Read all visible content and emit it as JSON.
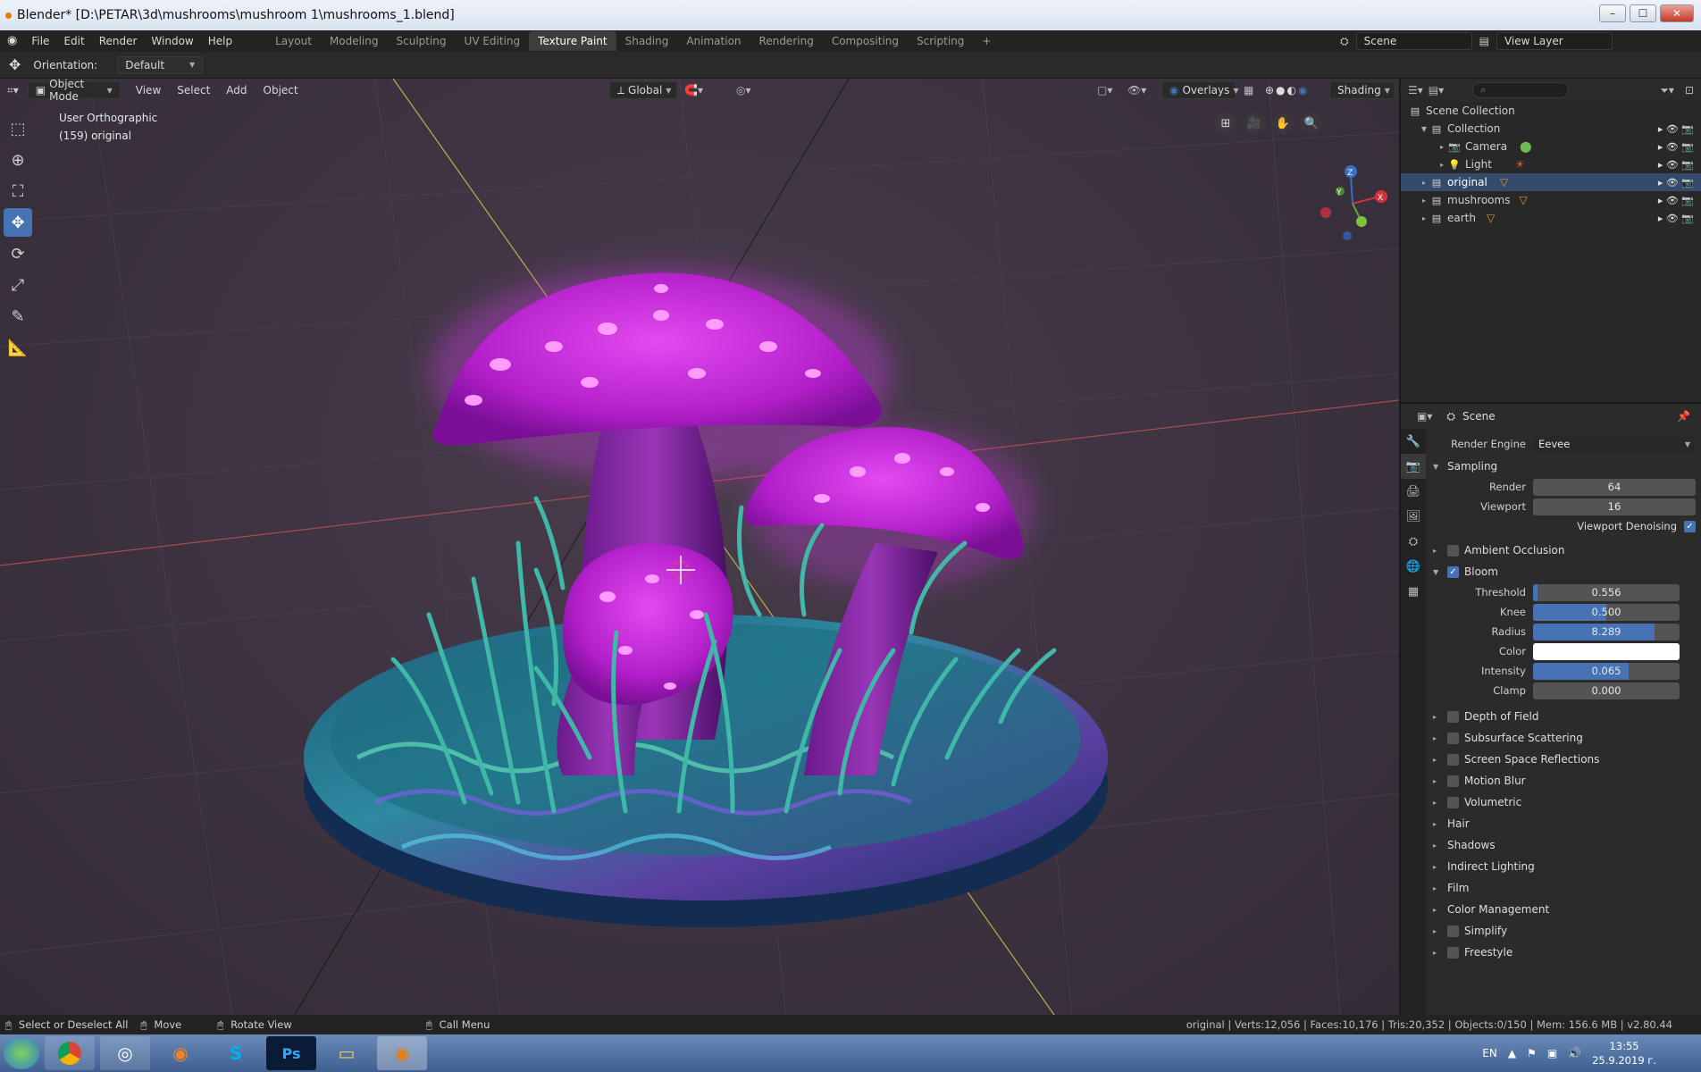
{
  "window": {
    "title": "Blender* [D:\\PETAR\\3d\\mushrooms\\mushroom 1\\mushrooms_1.blend]",
    "minimize": "–",
    "maximize": "☐",
    "close": "✕"
  },
  "menubar": {
    "logo": "◉",
    "items": [
      "File",
      "Edit",
      "Render",
      "Window",
      "Help"
    ],
    "workspaces": [
      "Layout",
      "Modeling",
      "Sculpting",
      "UV Editing",
      "Texture Paint",
      "Shading",
      "Animation",
      "Rendering",
      "Compositing",
      "Scripting"
    ],
    "active_workspace": "Texture Paint",
    "add_tab": "+",
    "scene": "Scene",
    "view_layer": "View Layer"
  },
  "tool_header": {
    "orientation_label": "Orientation:",
    "orientation_value": "Default"
  },
  "viewport_header": {
    "mode": "Object Mode",
    "menus": [
      "View",
      "Select",
      "Add",
      "Object"
    ],
    "transform": "Global",
    "overlays": "Overlays",
    "shading": "Shading"
  },
  "viewport": {
    "view_name": "User Orthographic",
    "object_info": "(159) original",
    "gizmo": {
      "z": "Z",
      "y": "Y",
      "x": "X"
    }
  },
  "outliner": {
    "search_placeholder": "",
    "rows": [
      {
        "label": "Scene Collection",
        "icon": "collection-icon"
      },
      {
        "label": "Collection",
        "icon": "collection-icon"
      },
      {
        "label": "Camera",
        "icon": "camera-icon"
      },
      {
        "label": "Light",
        "icon": "light-icon"
      },
      {
        "label": "original",
        "icon": "collection-icon"
      },
      {
        "label": "mushrooms",
        "icon": "collection-icon"
      },
      {
        "label": "earth",
        "icon": "collection-icon"
      }
    ]
  },
  "properties": {
    "header": "Scene",
    "render_engine_label": "Render Engine",
    "render_engine": "Eevee",
    "sampling": {
      "title": "Sampling",
      "render_label": "Render",
      "render": "64",
      "viewport_label": "Viewport",
      "viewport": "16",
      "denoise_label": "Viewport Denoising"
    },
    "ambient_occlusion": "Ambient Occlusion",
    "bloom": {
      "title": "Bloom",
      "threshold_label": "Threshold",
      "threshold": "0.556",
      "threshold_fill": 0.03,
      "knee_label": "Knee",
      "knee": "0.500",
      "knee_fill": 0.5,
      "radius_label": "Radius",
      "radius": "8.289",
      "radius_fill": 0.83,
      "color_label": "Color",
      "color": "#ffffff",
      "intensity_label": "Intensity",
      "intensity": "0.065",
      "intensity_fill": 0.65,
      "clamp_label": "Clamp",
      "clamp": "0.000",
      "clamp_fill": 0.0
    },
    "panels_checkbox": [
      "Depth of Field",
      "Subsurface Scattering",
      "Screen Space Reflections",
      "Motion Blur",
      "Volumetric"
    ],
    "panels_plain": [
      "Hair",
      "Shadows",
      "Indirect Lighting",
      "Film",
      "Color Management"
    ],
    "panels_checkbox2": [
      "Simplify",
      "Freestyle"
    ]
  },
  "statusbar": {
    "select": "Select or Deselect All",
    "move": "Move",
    "rotate": "Rotate View",
    "call_menu": "Call Menu",
    "stats": "original | Verts:12,056 | Faces:10,176 | Tris:20,352 | Objects:0/150 | Mem: 156.6 MB | v2.80.44"
  },
  "taskbar": {
    "lang": "EN",
    "time": "13:55",
    "date": "25.9.2019 г.",
    "apps": [
      "chrome",
      "steam",
      "firefox",
      "skype",
      "photoshop",
      "explorer",
      "blender"
    ]
  },
  "colors": {
    "accent": "#4772b3",
    "mushroom": "#c026d3",
    "grass": "#3fb8a8"
  }
}
